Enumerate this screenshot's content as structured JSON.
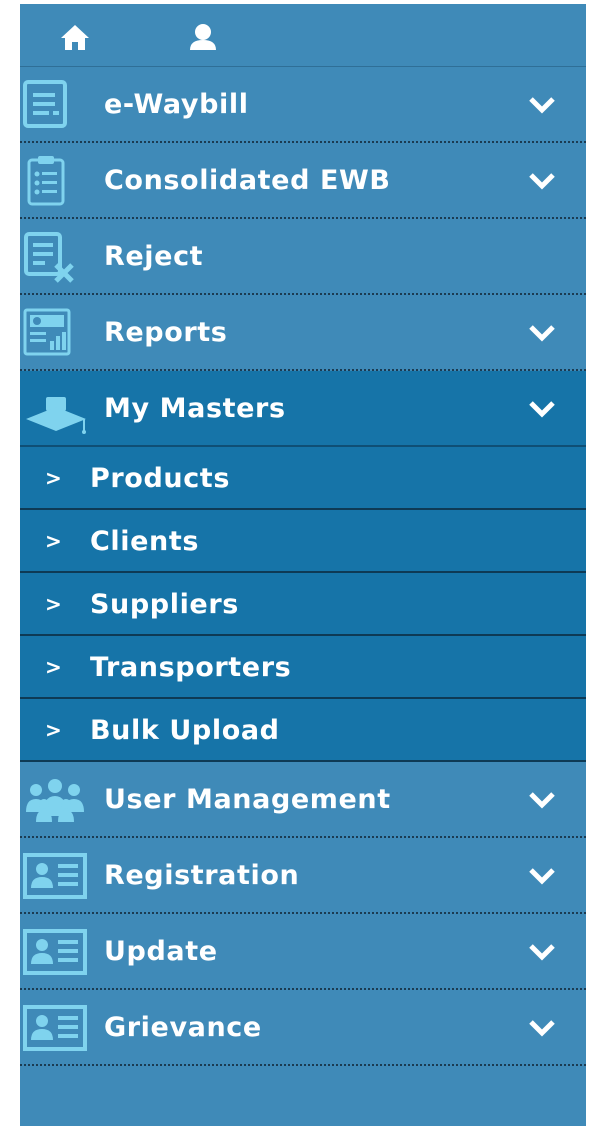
{
  "topbar": {
    "icons": [
      "home-icon",
      "user-icon"
    ]
  },
  "menu": {
    "items": [
      {
        "label": "e-Waybill",
        "icon": "document-list-icon",
        "has_submenu": true
      },
      {
        "label": "Consolidated EWB",
        "icon": "clipboard-icon",
        "has_submenu": true
      },
      {
        "label": "Reject",
        "icon": "reject-document-icon",
        "has_submenu": false
      },
      {
        "label": "Reports",
        "icon": "report-chart-icon",
        "has_submenu": true
      },
      {
        "label": "My Masters",
        "icon": "graduation-cap-icon",
        "has_submenu": true,
        "expanded": true
      },
      {
        "label": "User Management",
        "icon": "users-group-icon",
        "has_submenu": true
      },
      {
        "label": "Registration",
        "icon": "id-card-icon",
        "has_submenu": true
      },
      {
        "label": "Update",
        "icon": "id-card-icon",
        "has_submenu": true
      },
      {
        "label": "Grievance",
        "icon": "id-card-icon",
        "has_submenu": true
      }
    ],
    "my_masters_submenu": [
      {
        "label": "Products"
      },
      {
        "label": "Clients"
      },
      {
        "label": "Suppliers"
      },
      {
        "label": "Transporters"
      },
      {
        "label": "Bulk Upload"
      }
    ],
    "submenu_arrow": ">"
  },
  "colors": {
    "sidebar_bg": "#3f8ab8",
    "active_bg": "#1674a8",
    "icon_accent": "#7fd3ee",
    "text": "#ffffff"
  }
}
